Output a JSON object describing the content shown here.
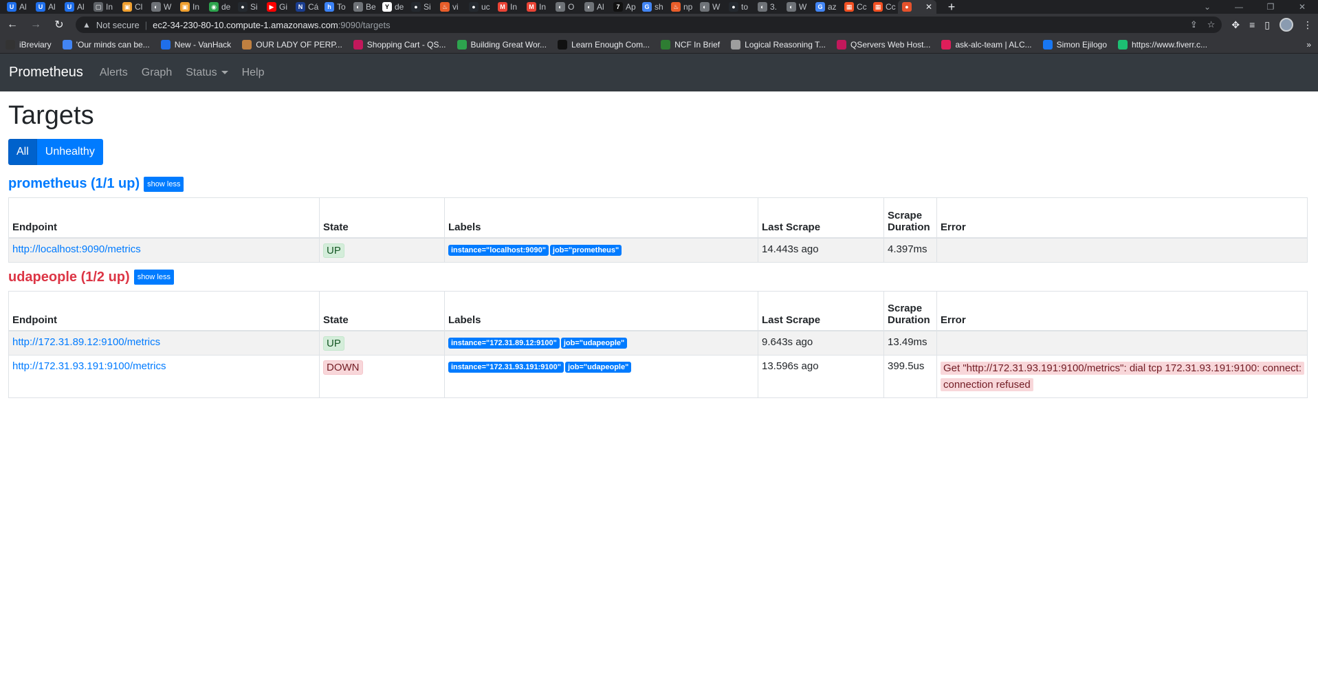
{
  "browser": {
    "tabs": [
      {
        "label": "Al",
        "color": "#1f6feb",
        "glyph": "U"
      },
      {
        "label": "Al",
        "color": "#1f6feb",
        "glyph": "U"
      },
      {
        "label": "Al",
        "color": "#1f6feb",
        "glyph": "U"
      },
      {
        "label": "In",
        "color": "#5f6368",
        "glyph": "▢"
      },
      {
        "label": "Cl",
        "color": "#f0a030",
        "glyph": "▣"
      },
      {
        "label": "W",
        "color": "#6f7378",
        "glyph": "◐"
      },
      {
        "label": "In",
        "color": "#f0a030",
        "glyph": "▣"
      },
      {
        "label": "de",
        "color": "#2da44e",
        "glyph": "◉"
      },
      {
        "label": "Si",
        "color": "#24292f",
        "glyph": "●"
      },
      {
        "label": "Gi",
        "color": "#ff0000",
        "glyph": "▶"
      },
      {
        "label": "Cá",
        "color": "#1a3d8f",
        "glyph": "N"
      },
      {
        "label": "To",
        "color": "#3b82f6",
        "glyph": "h"
      },
      {
        "label": "Be",
        "color": "#6f7378",
        "glyph": "◐"
      },
      {
        "label": "de",
        "color": "#ffffff",
        "glyph": "Y"
      },
      {
        "label": "Si",
        "color": "#24292f",
        "glyph": "●"
      },
      {
        "label": "vi",
        "color": "#e85d2a",
        "glyph": "♨"
      },
      {
        "label": "uc",
        "color": "#24292f",
        "glyph": "●"
      },
      {
        "label": "In",
        "color": "#ea4335",
        "glyph": "M"
      },
      {
        "label": "In",
        "color": "#ea4335",
        "glyph": "M"
      },
      {
        "label": "O",
        "color": "#6f7378",
        "glyph": "◐"
      },
      {
        "label": "Al",
        "color": "#6f7378",
        "glyph": "◐"
      },
      {
        "label": "Ap",
        "color": "#111111",
        "glyph": "7"
      },
      {
        "label": "sh",
        "color": "#4285f4",
        "glyph": "G"
      },
      {
        "label": "np",
        "color": "#e85d2a",
        "glyph": "♨"
      },
      {
        "label": "W",
        "color": "#6f7378",
        "glyph": "◐"
      },
      {
        "label": "to",
        "color": "#24292f",
        "glyph": "●"
      },
      {
        "label": "3.",
        "color": "#6f7378",
        "glyph": "◐"
      },
      {
        "label": "W",
        "color": "#6f7378",
        "glyph": "◐"
      },
      {
        "label": "az",
        "color": "#4285f4",
        "glyph": "G"
      },
      {
        "label": "Cc",
        "color": "#f25022",
        "glyph": "▦"
      },
      {
        "label": "Cc",
        "color": "#f25022",
        "glyph": "▦"
      }
    ],
    "active_tab_color": "#e6522c",
    "new_tab": "+",
    "window_controls": [
      "⌄",
      "—",
      "❐",
      "✕"
    ],
    "omnibox": {
      "security": "Not secure",
      "host": "ec2-34-230-80-10.compute-1.amazonaws.com",
      "path": ":9090/targets"
    },
    "bookmarks": [
      {
        "label": "iBreviary",
        "color": "#333333"
      },
      {
        "label": "'Our minds can be...",
        "color": "#4285f4"
      },
      {
        "label": "New - VanHack",
        "color": "#1f6feb"
      },
      {
        "label": "OUR LADY OF PERP...",
        "color": "#c08040"
      },
      {
        "label": "Shopping Cart - QS...",
        "color": "#c2185b"
      },
      {
        "label": "Building Great Wor...",
        "color": "#2da44e"
      },
      {
        "label": "Learn Enough Com...",
        "color": "#111111"
      },
      {
        "label": "NCF In Brief",
        "color": "#2e7d32"
      },
      {
        "label": "Logical Reasoning T...",
        "color": "#9e9e9e"
      },
      {
        "label": "QServers Web Host...",
        "color": "#c2185b"
      },
      {
        "label": "ask-alc-team | ALC...",
        "color": "#e01e5a"
      },
      {
        "label": "Simon Ejilogo",
        "color": "#1877f2"
      },
      {
        "label": "https://www.fiverr.c...",
        "color": "#1dbf73"
      }
    ],
    "bookmarks_more": "»"
  },
  "nav": {
    "brand": "Prometheus",
    "links": [
      "Alerts",
      "Graph",
      "Status",
      "Help"
    ]
  },
  "page": {
    "title": "Targets",
    "filters": {
      "all": "All",
      "unhealthy": "Unhealthy"
    },
    "columns": [
      "Endpoint",
      "State",
      "Labels",
      "Last Scrape",
      "Scrape Duration",
      "Error"
    ],
    "pools": [
      {
        "title": "prometheus (1/1 up)",
        "healthy": true,
        "toggle": "show less",
        "rows": [
          {
            "endpoint": "http://localhost:9090/metrics",
            "state": "UP",
            "labels": [
              "instance=\"localhost:9090\"",
              "job=\"prometheus\""
            ],
            "last_scrape": "14.443s ago",
            "duration": "4.397ms",
            "error": ""
          }
        ]
      },
      {
        "title": "udapeople (1/2 up)",
        "healthy": false,
        "toggle": "show less",
        "rows": [
          {
            "endpoint": "http://172.31.89.12:9100/metrics",
            "state": "UP",
            "labels": [
              "instance=\"172.31.89.12:9100\"",
              "job=\"udapeople\""
            ],
            "last_scrape": "9.643s ago",
            "duration": "13.49ms",
            "error": ""
          },
          {
            "endpoint": "http://172.31.93.191:9100/metrics",
            "state": "DOWN",
            "labels": [
              "instance=\"172.31.93.191:9100\"",
              "job=\"udapeople\""
            ],
            "last_scrape": "13.596s ago",
            "duration": "399.5us",
            "error": "Get \"http://172.31.93.191:9100/metrics\": dial tcp 172.31.93.191:9100: connect: connection refused"
          }
        ]
      }
    ]
  }
}
